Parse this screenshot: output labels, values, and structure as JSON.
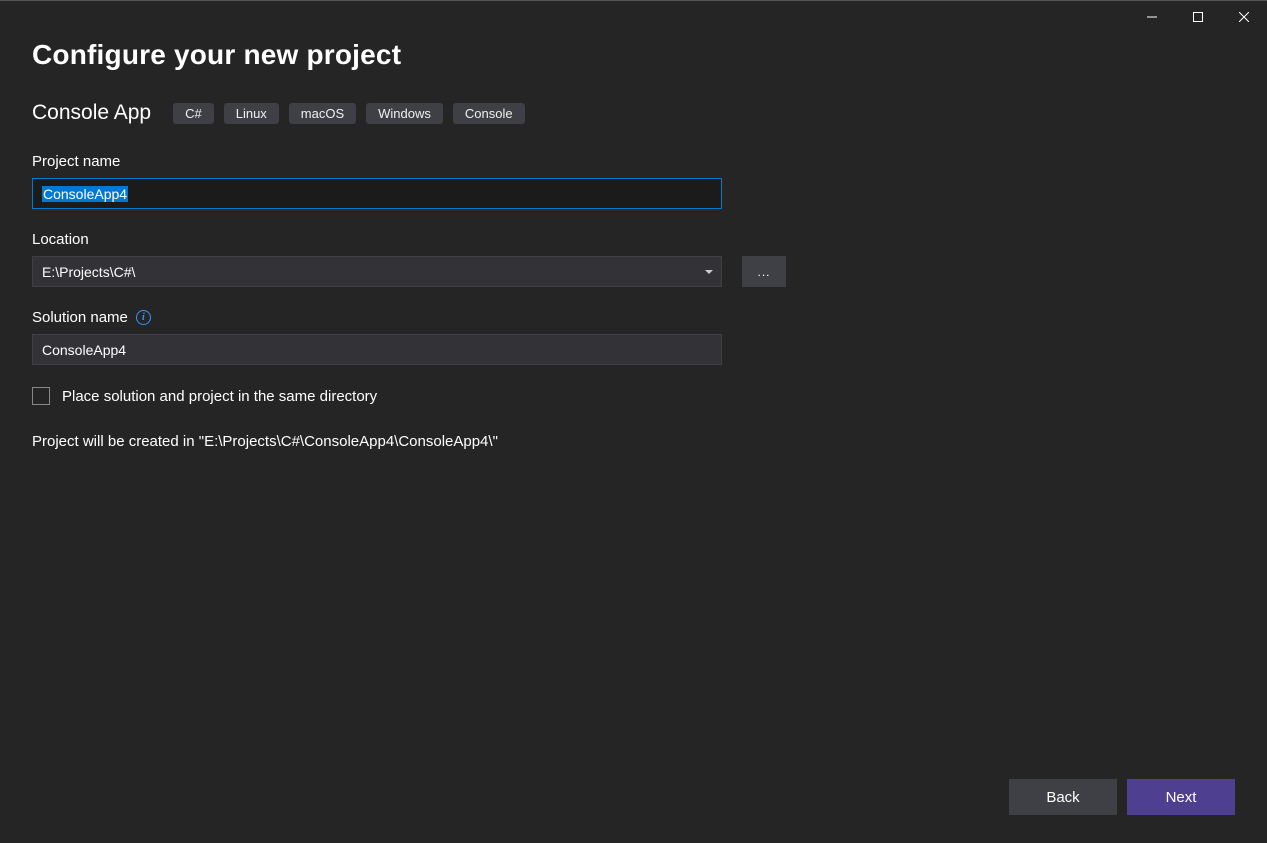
{
  "window": {
    "title": "Configure your new project"
  },
  "template": {
    "name": "Console App",
    "tags": [
      "C#",
      "Linux",
      "macOS",
      "Windows",
      "Console"
    ]
  },
  "fields": {
    "project_name_label": "Project name",
    "project_name_value": "ConsoleApp4",
    "location_label": "Location",
    "location_value": "E:\\Projects\\C#\\",
    "browse_label": "...",
    "solution_name_label": "Solution name",
    "solution_name_value": "ConsoleApp4",
    "same_dir_label": "Place solution and project in the same directory",
    "same_dir_checked": false
  },
  "hint": "Project will be created in \"E:\\Projects\\C#\\ConsoleApp4\\ConsoleApp4\\\"",
  "buttons": {
    "back": "Back",
    "next": "Next"
  }
}
